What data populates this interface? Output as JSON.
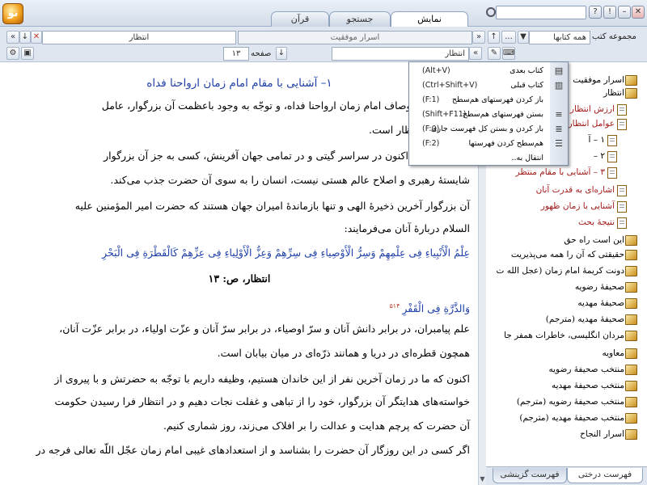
{
  "app": {
    "logo_text": "نو"
  },
  "tabs": [
    {
      "label": "نمایش",
      "active": true
    },
    {
      "label": "جستجو",
      "active": false
    },
    {
      "label": "قرآن",
      "active": false
    }
  ],
  "window_buttons": {
    "close": "✕",
    "maximize": "□",
    "minimize": "–",
    "help": "?",
    "info": "!"
  },
  "toolbar": {
    "search_placeholder": "",
    "book_title": "اسرار موفقیت",
    "section_title": "انتظار",
    "current_book": "انتظار",
    "page_label": "صفحه",
    "page_number": "۱۳",
    "collection_label": "مجموعه کتب",
    "collection_value": "همه کتابها",
    "more_button": "..."
  },
  "content": {
    "heading": "۱– آشنایی با مقام امام زمان ارواحنا فداه",
    "lines": [
      "خصوصیّات و اوصاف امام زمان ارواحنا فداه، و توجّه به وجود باعظمت آن بزرگوار، عامل",
      "ایجاد حالت انتظار است.",
      "به این نکته که اکنون در سراسر گیتی و در تمامی جهان آفرینش، کسی به جز آن بزرگوار",
      "شایستهٔ رهبری و اصلاح عالم هستی نیست، انسان را به سوی آن حضرت جذب می‌کند.",
      "آن بزرگوار آخرین ذخیرهٔ الهی و تنها بازماندهٔ امیران جهان هستند که حضرت امیر المؤمنین علیه",
      "السلام دربارهٔ آنان می‌فرمایند:"
    ],
    "quote_1": "عِلْمُ الْأَنْبِیاءِ فِی عِلْمِهِمْ وَسِرُّ الْأَوْصِیاءِ فِی سِرِّهِمْ وَعِزُّ الْأَوْلِیاءِ فِی عِزِّهِمْ کَالْقَطْرَةِ فِی الْبَحْرِ",
    "citation": "انتظار، ص: ۱۳",
    "quote_2": "وَالذَّرَّةِ فِی الْقَفْرِ",
    "quote_2_ref": "۵۱۴",
    "lines_2": [
      "علم پیامبران، در برابر دانش آنان و سرّ اوصیاء، در برابر سرّ آنان و عزّت اولیاء، در برابر عزّت آنان،",
      "همچون قطره‌ای در دریا و همانند ذرّه‌ای در میان بیابان است.",
      "اکنون که ما در زمان آخرین نفر از این خاندان هستیم، وظیفه داریم با توجّه به حضرتش و با پیروی از",
      "خواسته‌های هدایتگر آن بزرگوار، خود را از تباهی و غفلت نجات دهیم و در انتظار فرا رسیدن حکومت",
      "آن حضرت که پرچم هدایت و عدالت را بر افلاک می‌زند، روز شماری کنیم.",
      "اگر کسی در این روزگار آن حضرت را بشناسد و از استعدادهای غیبی امام زمان عجّل اللّه تعالی فرجه در"
    ]
  },
  "context_menu": {
    "items": [
      {
        "label": "کتاب بعدی",
        "key": "(Alt+V)",
        "icon": "book-next-icon"
      },
      {
        "label": "کتاب قبلی",
        "key": "(Ctrl+Shift+V)",
        "icon": "book-prev-icon"
      },
      {
        "label": "باز کردن فهرستهای هم‌سطح",
        "key": "(F:1)",
        "icon": ""
      },
      {
        "label": "بستن فهرستهای هم‌سطح",
        "key": "(Shift+F11)",
        "icon": "collapse-list-icon"
      },
      {
        "label": "باز کردن و بستن کل فهرست جاری",
        "key": "(F:0)",
        "icon": "toggle-list-icon"
      },
      {
        "label": "هم‌سطح کردن فهرستها",
        "key": "(F:2)",
        "icon": "level-list-icon"
      },
      {
        "label": "انتقال به..",
        "key": "",
        "icon": ""
      }
    ]
  },
  "sidebar": {
    "tree": [
      {
        "label": "اسرار موفقیت",
        "type": "book",
        "red": false
      },
      {
        "label": "انتظار",
        "type": "book",
        "red": false
      },
      {
        "label": "ارزش انتظار",
        "type": "doc",
        "red": true
      },
      {
        "label": "عوامل انتظار",
        "type": "doc",
        "red": true
      },
      {
        "label": "۱ – آ",
        "type": "doc",
        "red": false
      },
      {
        "label": "۲ –",
        "type": "doc",
        "red": false
      },
      {
        "label": "۳ – آشنایی با مقام منتظر",
        "type": "doc",
        "red": true
      },
      {
        "label": "اشاره‌ای به قدرت آنان",
        "type": "doc",
        "red": true
      },
      {
        "label": "آشنایی با زمان ظهور",
        "type": "doc",
        "red": true
      },
      {
        "label": "نتیجهٔ بحث",
        "type": "doc",
        "red": true
      },
      {
        "label": "این است راه حق",
        "type": "book",
        "red": false
      },
      {
        "label": "حقیقتی که آن را همه می‌پذیریت",
        "type": "book",
        "red": false
      },
      {
        "label": "دونت کریمهٔ امام زمان (عجل الله ت",
        "type": "book",
        "red": false
      },
      {
        "label": "صحیفهٔ رضویه",
        "type": "book",
        "red": false
      },
      {
        "label": "صحیفهٔ مهدیه",
        "type": "book",
        "red": false
      },
      {
        "label": "صحیفهٔ مهدیه (مترجم)",
        "type": "book",
        "red": false
      },
      {
        "label": "مردان انگلیسی، خاطرات همفر جا",
        "type": "book",
        "red": false
      },
      {
        "label": "معاویه",
        "type": "book",
        "red": false
      },
      {
        "label": "منتخب صحیفهٔ رضویه",
        "type": "book",
        "red": false
      },
      {
        "label": "منتخب صحیفهٔ مهدیه",
        "type": "book",
        "red": false
      },
      {
        "label": "منتخب صحیفهٔ رضویه (مترجم)",
        "type": "book",
        "red": false
      },
      {
        "label": "منتخب صحیفهٔ مهدیه (مترجم)",
        "type": "book",
        "red": false
      },
      {
        "label": "اسرار النجاح",
        "type": "book",
        "red": false
      }
    ],
    "bottom_tabs": [
      {
        "label": "فهرست درختی",
        "active": true
      },
      {
        "label": "فهرست گزینشی",
        "active": false
      }
    ]
  },
  "colors": {
    "accent": "#1f3fa8",
    "red_item": "#a31a1a",
    "toolbar": "#dfe6ef"
  }
}
